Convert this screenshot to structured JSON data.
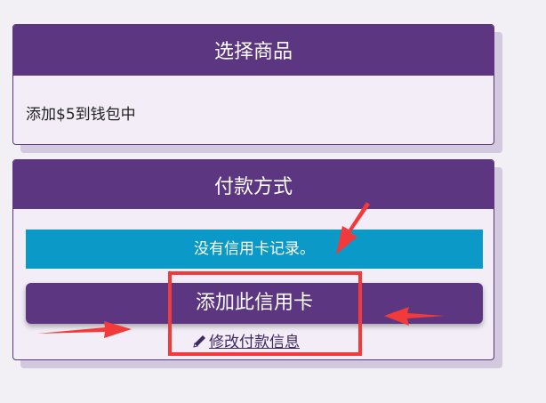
{
  "product_card": {
    "title": "选择商品",
    "item": "添加$5到钱包中"
  },
  "payment_card": {
    "title": "付款方式",
    "notice": "没有信用卡记录。",
    "add_card_label": "添加此信用卡",
    "edit_payment_label": "修改付款信息"
  },
  "icons": {
    "edit": "pencil-icon"
  },
  "colors": {
    "header_purple": "#5c3680",
    "notice_blue": "#0b9ac8",
    "annotation_red": "#f23a3a"
  }
}
